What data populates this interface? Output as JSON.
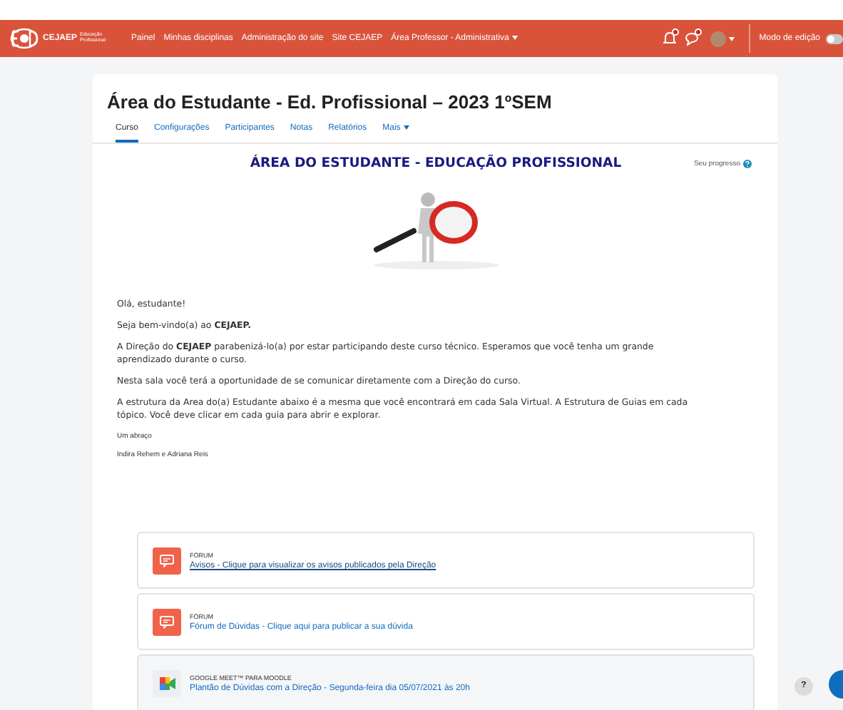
{
  "navbar": {
    "logo_text": "CEJAEP",
    "logo_sub": "Educação Profissional",
    "items": [
      {
        "label": "Painel",
        "dropdown": false
      },
      {
        "label": "Minhas disciplinas",
        "dropdown": false
      },
      {
        "label": "Administração do site",
        "dropdown": false
      },
      {
        "label": "Site CEJAEP",
        "dropdown": false
      },
      {
        "label": "Área Professor - Administrativa",
        "dropdown": true
      }
    ],
    "notifications_badge": true,
    "messages_badge": true,
    "edit_mode": {
      "label": "Modo de edição",
      "on": false
    }
  },
  "course": {
    "title": "Área do Estudante - Ed. Profissional – 2023 1ºSEM",
    "tabs": [
      {
        "label": "Curso",
        "selected": true,
        "dropdown": false
      },
      {
        "label": "Configurações",
        "selected": false,
        "dropdown": false
      },
      {
        "label": "Participantes",
        "selected": false,
        "dropdown": false
      },
      {
        "label": "Notas",
        "selected": false,
        "dropdown": false
      },
      {
        "label": "Relatórios",
        "selected": false,
        "dropdown": false
      },
      {
        "label": "Mais",
        "selected": false,
        "dropdown": true
      }
    ]
  },
  "progress_label": "Seu progresso",
  "heading": "ÁREA DO ESTUDANTE - EDUCAÇÃO PROFISSIONAL",
  "paragraphs": [
    {
      "text": "Olá, estudante!",
      "small": false
    },
    {
      "text": "Seja bem-vindo(a) ao **CEJAEP.**",
      "small": false
    },
    {
      "text": "A Direção do **CEJAEP**  parabenizá-lo(a) por estar participando deste curso técnico. Esperamos que você tenha um grande aprendizado durante o curso.",
      "small": false
    },
    {
      "text": "Nesta sala você terá a oportunidade de se comunicar diretamente com a Direção do curso.",
      "small": false
    },
    {
      "text": "A estrutura da Area do(a) Estudante abaixo é a mesma que você encontrará em cada Sala Virtual.  A Estrutura de Guias em cada tópico. Você deve clicar em cada guia para abrir e explorar.",
      "small": false
    },
    {
      "text": "Um abraço",
      "small": true
    },
    {
      "text": "Indira Rehem e Adriana Reis",
      "small": true
    }
  ],
  "activities": [
    {
      "kind": "forum",
      "type_label": "FÓRUM",
      "link": "Avisos - Clique para visualizar os avisos publicados pela Direção"
    },
    {
      "kind": "forum",
      "type_label": "FÓRUM",
      "link": "Fórum de Dúvidas - Clique aqui para publicar a sua dúvida"
    },
    {
      "kind": "meet",
      "type_label": "GOOGLE MEET™ PARA MOODLE",
      "link": "Plantão de Dúvidas com a Direção - Segunda-feira dia 05/07/2021 às 20h"
    }
  ],
  "help_button": "?"
}
